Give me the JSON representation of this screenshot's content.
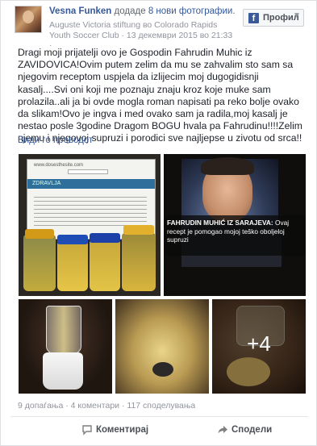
{
  "post": {
    "author": "Vesna Funken",
    "action_prefix": "додаде ",
    "action_highlight": "8 нови фотографии",
    "action_suffix": ".",
    "meta": "Auguste Victoria stiftung во Colorado Rapids Youth Soccer Club · 13 декември 2015 во 21:33 ·",
    "profile_button": "Профил",
    "text": "Dragi moji prijatelji ovo je Gospodin Fahrudin Muhic iz ZAVIDOVICA!Ovim putem zelim da mu se zahvalim sto sam sa njegovim receptom uspjela da izlijecim moj dugogidisnji kasalj....Svi oni koji me poznaju znaju kroz koje muke sam prolazila..ali ja bi ovde mogla roman napisati pa reko bolje ovako da slikam!Ovo je ingva i med ovako sam ja radila,moj kasalj je nestao posle 3godine Dragom BOGU hvala pa Fahrudinu!!!!Zelim njemu i njegovoj supruzi i porodici sve najljepse u zivotu od srca!!",
    "translate_link": "Види го преводот"
  },
  "photos": {
    "photo1": {
      "site": "www.dosesthesite.com",
      "band": "ZDRAVLJA"
    },
    "photo2": {
      "caption_name": "FAHRUDIN MUHIĆ IZ SARAJEVA:",
      "caption_text": " Ovaj recept je pomogao mojoj teško oboljeloj supruzi"
    },
    "more_count": "+4"
  },
  "stats": {
    "likes": "9 допаѓања",
    "comments": "4 коментари",
    "shares": "117 споделувања",
    "separator": " · "
  },
  "actions": {
    "comment": "Коментирај",
    "share": "Сподели"
  },
  "icons": {
    "facebook": "facebook-icon",
    "chevron": "chevron-down-icon",
    "comment": "comment-icon",
    "share": "share-icon"
  },
  "colors": {
    "link": "#365899",
    "muted": "#90949c",
    "facebook_blue": "#3b5998"
  }
}
